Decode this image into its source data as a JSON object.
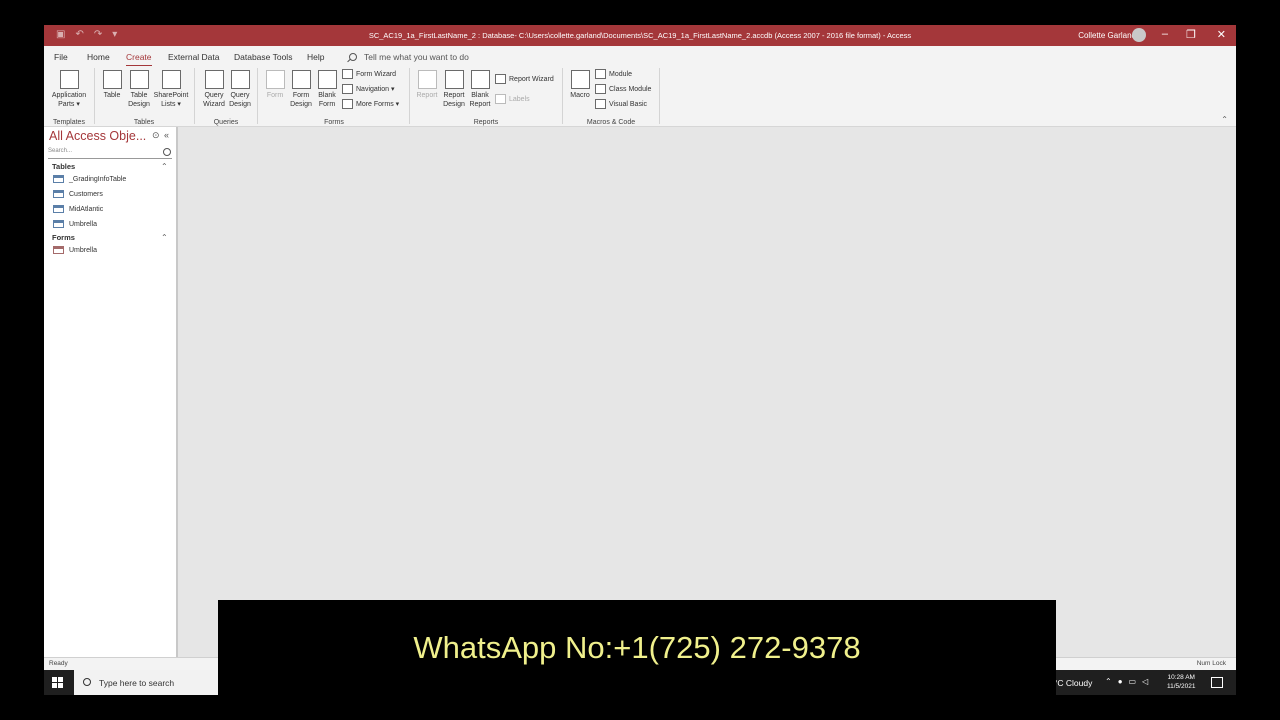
{
  "window": {
    "title": "SC_AC19_1a_FirstLastName_2 : Database- C:\\Users\\collette.garland\\Documents\\SC_AC19_1a_FirstLastName_2.accdb (Access 2007 - 2016 file format)  -  Access",
    "user": "Collette Garland",
    "accent": "#a4373a"
  },
  "tabs": [
    "File",
    "Home",
    "Create",
    "External Data",
    "Database Tools",
    "Help"
  ],
  "active_tab": "Create",
  "tell_me": "Tell me what you want to do",
  "ribbon": {
    "templates": {
      "label": "Templates",
      "application_parts": "Application Parts ▾"
    },
    "tables": {
      "label": "Tables",
      "table": "Table",
      "table_design": "Table Design",
      "sharepoint": "SharePoint Lists ▾"
    },
    "queries": {
      "label": "Queries",
      "query_wizard": "Query Wizard",
      "query_design": "Query Design"
    },
    "forms": {
      "label": "Forms",
      "form": "Form",
      "form_design": "Form Design",
      "blank_form": "Blank Form",
      "form_wizard": "Form Wizard",
      "navigation": "Navigation ▾",
      "more_forms": "More Forms ▾"
    },
    "reports": {
      "label": "Reports",
      "report": "Report",
      "report_design": "Report Design",
      "blank_report": "Blank Report",
      "report_wizard": "Report Wizard",
      "labels": "Labels"
    },
    "macros": {
      "label": "Macros & Code",
      "macro": "Macro",
      "module": "Module",
      "class_module": "Class Module",
      "visual_basic": "Visual Basic"
    }
  },
  "nav_pane": {
    "title": "All Access Obje...",
    "search_placeholder": "Search...",
    "groups": [
      {
        "name": "Tables",
        "items": [
          "_GradingInfoTable",
          "Customers",
          "MidAtlantic",
          "Umbrella"
        ]
      },
      {
        "name": "Forms",
        "items": [
          "Umbrella"
        ]
      }
    ]
  },
  "status": {
    "ready": "Ready",
    "num_lock": "Num Lock"
  },
  "taskbar": {
    "search": "Type here to search",
    "weather": "°C  Cloudy",
    "time": "10:28 AM",
    "date": "11/5/2021"
  },
  "overlay": {
    "text": "WhatsApp No:+1(725) 272-9378"
  }
}
